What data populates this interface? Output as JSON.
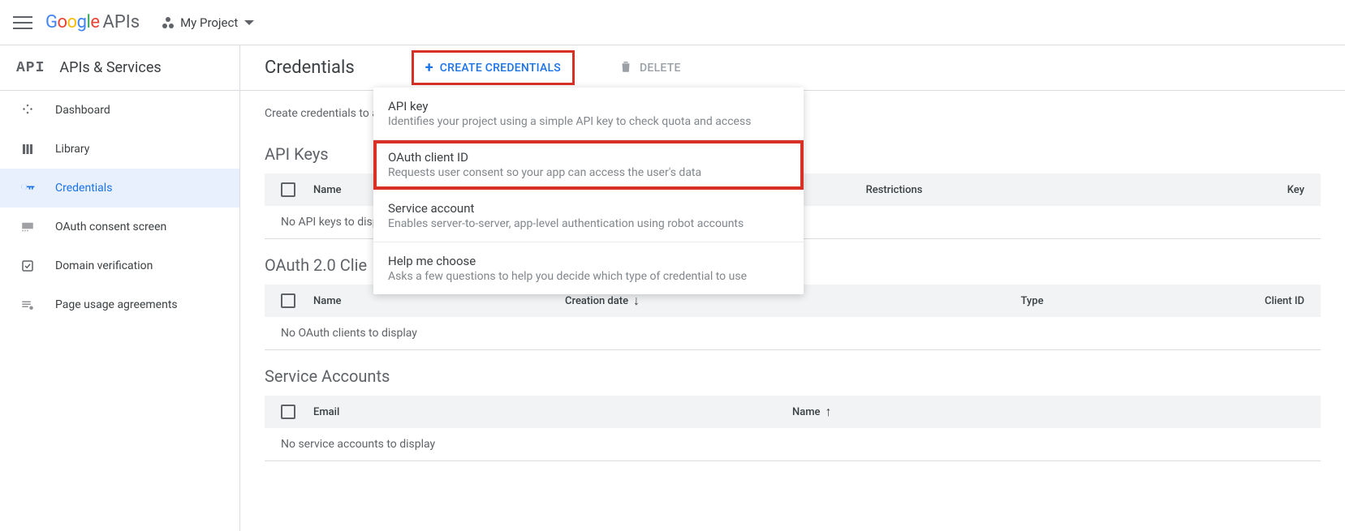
{
  "header": {
    "project_name": "My Project",
    "apis_label": "APIs"
  },
  "sidebar": {
    "product_title": "APIs & Services",
    "items": [
      {
        "label": "Dashboard"
      },
      {
        "label": "Library"
      },
      {
        "label": "Credentials"
      },
      {
        "label": "OAuth consent screen"
      },
      {
        "label": "Domain verification"
      },
      {
        "label": "Page usage agreements"
      }
    ]
  },
  "page": {
    "title": "Credentials",
    "create_btn": "CREATE CREDENTIALS",
    "delete_btn": "DELETE",
    "intro": "Create credentials to ac"
  },
  "dropdown": {
    "items": [
      {
        "title": "API key",
        "desc": "Identifies your project using a simple API key to check quota and access"
      },
      {
        "title": "OAuth client ID",
        "desc": "Requests user consent so your app can access the user's data"
      },
      {
        "title": "Service account",
        "desc": "Enables server-to-server, app-level authentication using robot accounts"
      },
      {
        "title": "Help me choose",
        "desc": "Asks a few questions to help you decide which type of credential to use"
      }
    ]
  },
  "sections": {
    "api_keys": {
      "title": "API Keys",
      "cols": {
        "name": "Name",
        "restrictions": "Restrictions",
        "key": "Key"
      },
      "empty": "No API keys to displa"
    },
    "oauth": {
      "title": "OAuth 2.0 Clie",
      "cols": {
        "name": "Name",
        "creation": "Creation date",
        "type": "Type",
        "clientid": "Client ID"
      },
      "empty": "No OAuth clients to display"
    },
    "service": {
      "title": "Service Accounts",
      "cols": {
        "email": "Email",
        "name": "Name"
      },
      "empty": "No service accounts to display"
    }
  }
}
